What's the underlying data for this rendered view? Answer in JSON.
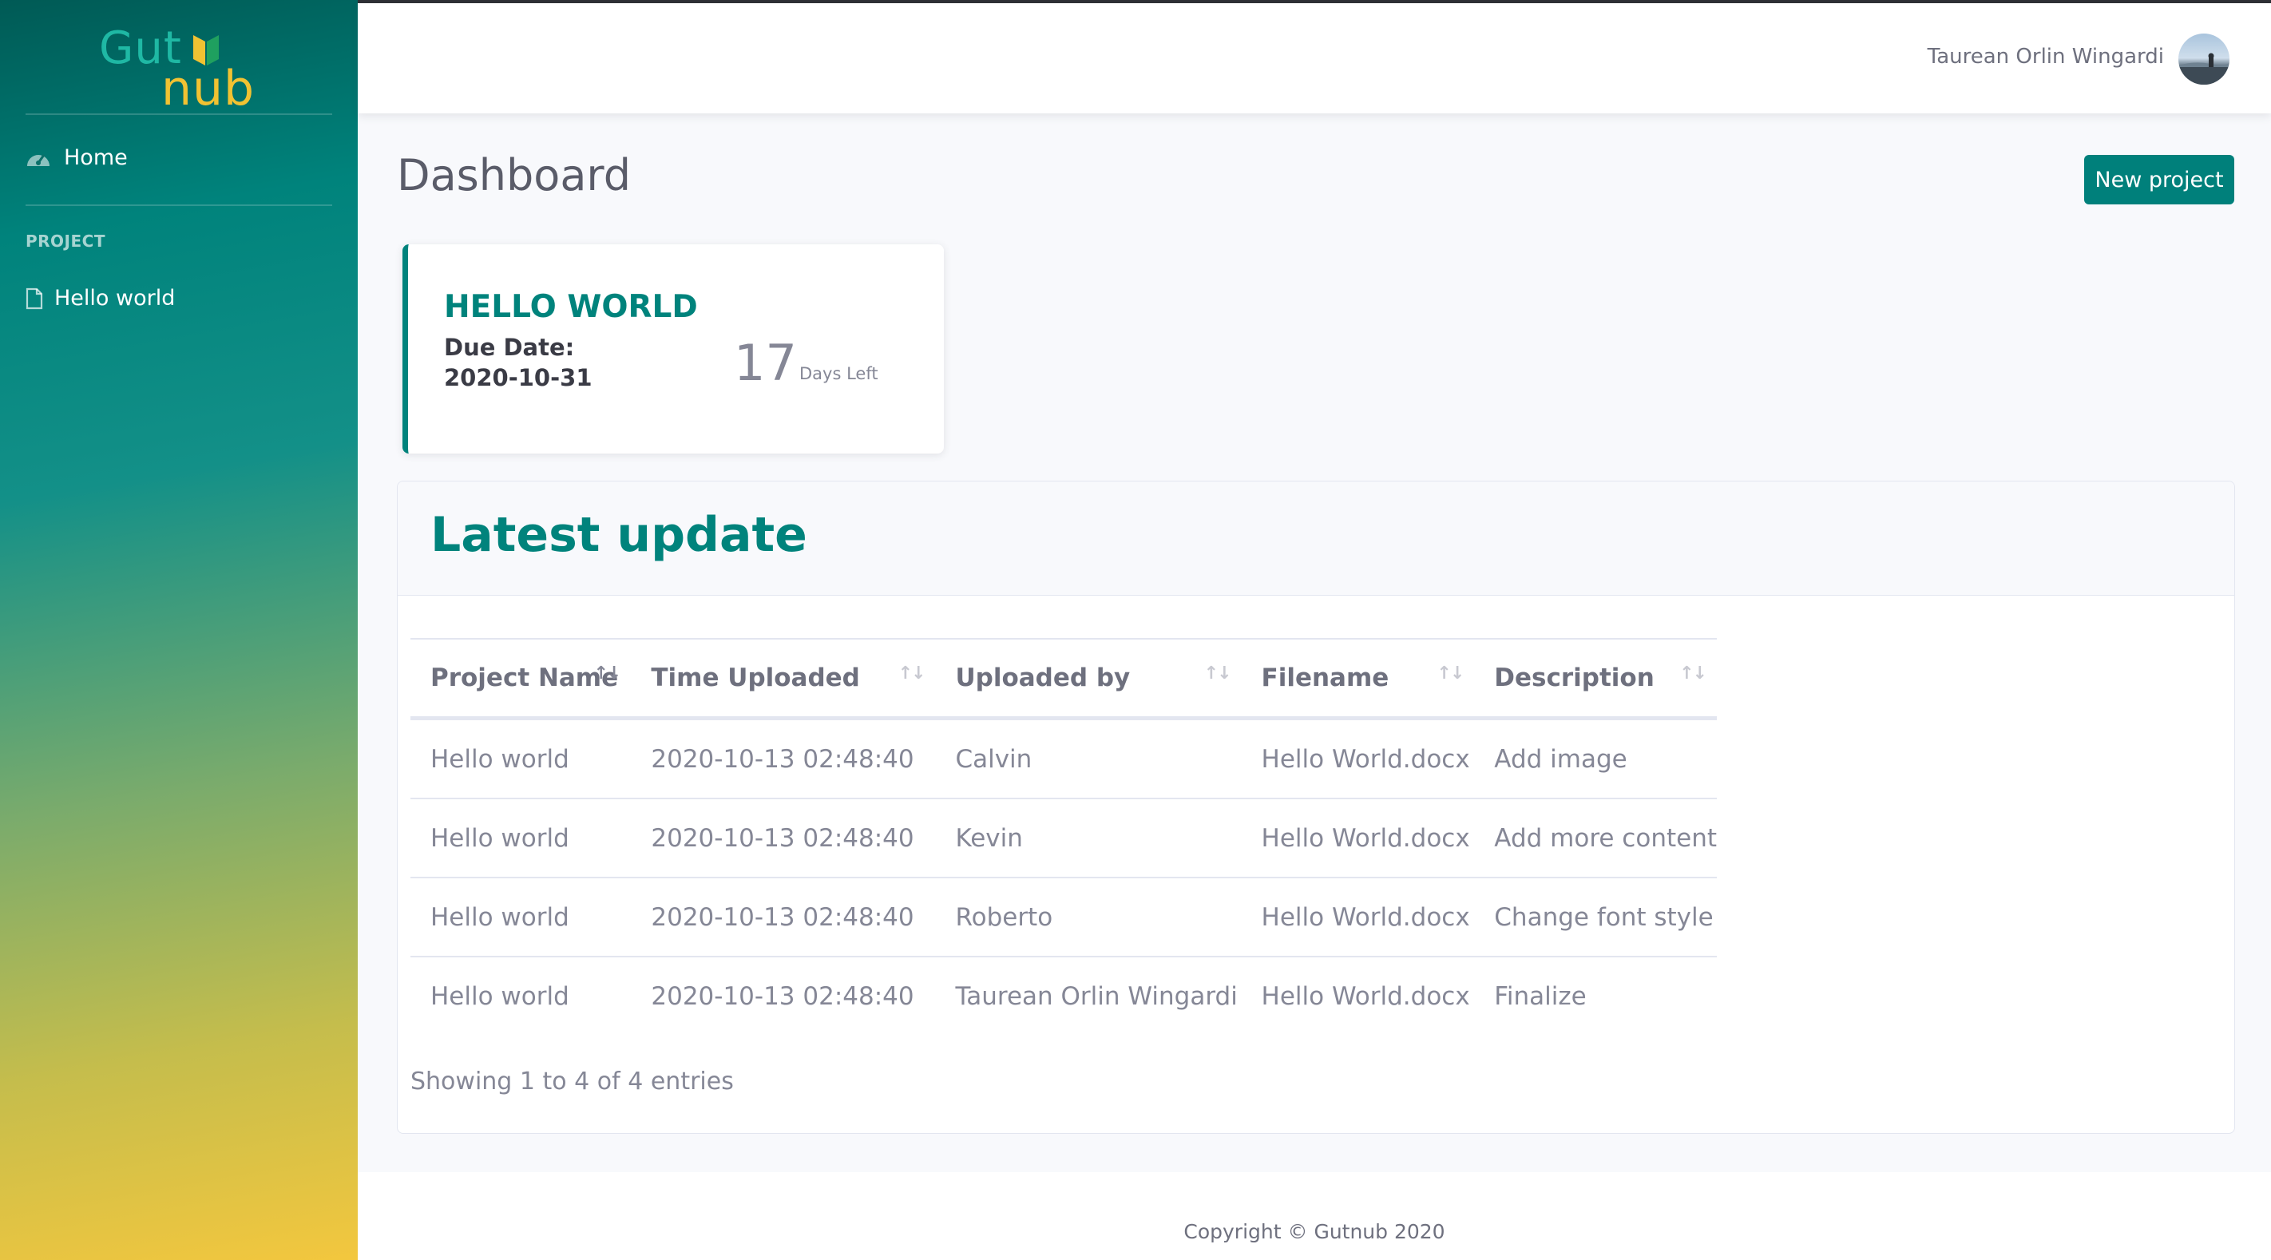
{
  "brand": {
    "line1": "Gut",
    "line2": "nub"
  },
  "sidebar": {
    "home_label": "Home",
    "section_heading": "PROJECT",
    "project_item": "Hello world"
  },
  "topbar": {
    "user_name": "Taurean Orlin Wingardi"
  },
  "main": {
    "page_title": "Dashboard",
    "new_project_label": "New project",
    "project_card": {
      "title": "HELLO WORLD",
      "due_label": "Due Date:",
      "due_date": "2020-10-31",
      "days_left": "17",
      "days_left_label": "Days Left"
    },
    "latest_update": {
      "title": "Latest update",
      "columns": [
        "Project Name",
        "Time Uploaded",
        "Uploaded by",
        "Filename",
        "Description"
      ],
      "rows": [
        [
          "Hello world",
          "2020-10-13 02:48:40",
          "Calvin",
          "Hello World.docx",
          "Add image"
        ],
        [
          "Hello world",
          "2020-10-13 02:48:40",
          "Kevin",
          "Hello World.docx",
          "Add more content"
        ],
        [
          "Hello world",
          "2020-10-13 02:48:40",
          "Roberto",
          "Hello World.docx",
          "Change font style"
        ],
        [
          "Hello world",
          "2020-10-13 02:48:40",
          "Taurean Orlin Wingardi",
          "Hello World.docx",
          "Finalize"
        ]
      ],
      "showing_text": "Showing 1 to 4 of 4 entries"
    }
  },
  "footer": {
    "copyright": "Copyright © Gutnub 2020"
  },
  "colors": {
    "accent": "#00837c",
    "brand_yellow": "#f1c232"
  }
}
